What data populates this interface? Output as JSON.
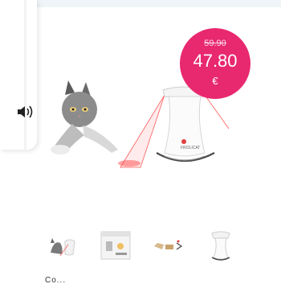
{
  "price": {
    "old": "59.90",
    "new": "47.80",
    "currency": "€"
  },
  "product": {
    "image_icon": "cat-laser-toy-image",
    "logo_text": "FROLICAT"
  },
  "sidebar": {
    "icon": "sound-icon"
  },
  "thumbnails": [
    {
      "icon": "cat-with-toy-thumbnail"
    },
    {
      "icon": "product-box-thumbnail"
    },
    {
      "icon": "accessories-thumbnail"
    },
    {
      "icon": "device-thumbnail"
    }
  ],
  "footer": {
    "partial_text": "Co..."
  },
  "colors": {
    "accent": "#e8286f",
    "top_strip": "#eef4f7"
  }
}
